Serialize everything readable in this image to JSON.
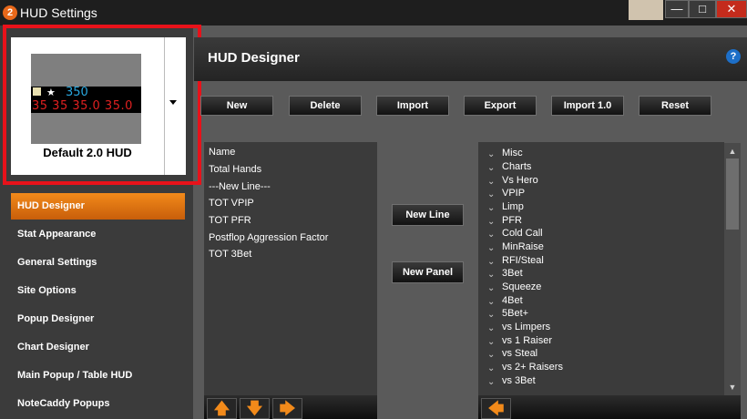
{
  "window": {
    "title": "HUD Settings",
    "app_icon": "2",
    "minimize": "—",
    "maximize": "□",
    "close": "✕"
  },
  "preview": {
    "hud_star": "★",
    "hud_value": "350",
    "hud_stats": "35 35 35.0 35.0",
    "hud_name": "Default 2.0 HUD"
  },
  "nav": {
    "items": [
      "HUD Designer",
      "Stat Appearance",
      "General Settings",
      "Site Options",
      "Popup Designer",
      "Chart Designer",
      "Main Popup / Table HUD",
      "NoteCaddy Popups"
    ],
    "active": "HUD Designer"
  },
  "main": {
    "title": "HUD Designer",
    "help": "?"
  },
  "toolbar": {
    "new": "New",
    "delete": "Delete",
    "import": "Import",
    "export": "Export",
    "import10": "Import 1.0",
    "reset": "Reset"
  },
  "left_list": [
    "Name",
    "Total Hands",
    "---New Line---",
    "TOT VPIP",
    "TOT PFR",
    "Postflop Aggression Factor",
    "TOT 3Bet"
  ],
  "middle": {
    "new_line": "New Line",
    "new_panel": "New Panel"
  },
  "right_list": [
    "Misc",
    "Charts",
    "Vs Hero",
    "VPIP",
    "Limp",
    "PFR",
    "Cold Call",
    "MinRaise",
    "RFI/Steal",
    "3Bet",
    "Squeeze",
    "4Bet",
    "5Bet+",
    "vs Limpers",
    "vs 1 Raiser",
    "vs Steal",
    "vs 2+ Raisers",
    "vs 3Bet"
  ],
  "bottom": {
    "up": "🡅",
    "down": "🡇",
    "right": "🡆",
    "left": "🡄"
  },
  "colors": {
    "accent": "#f28a1a",
    "highlight_box": "#e8121a"
  }
}
